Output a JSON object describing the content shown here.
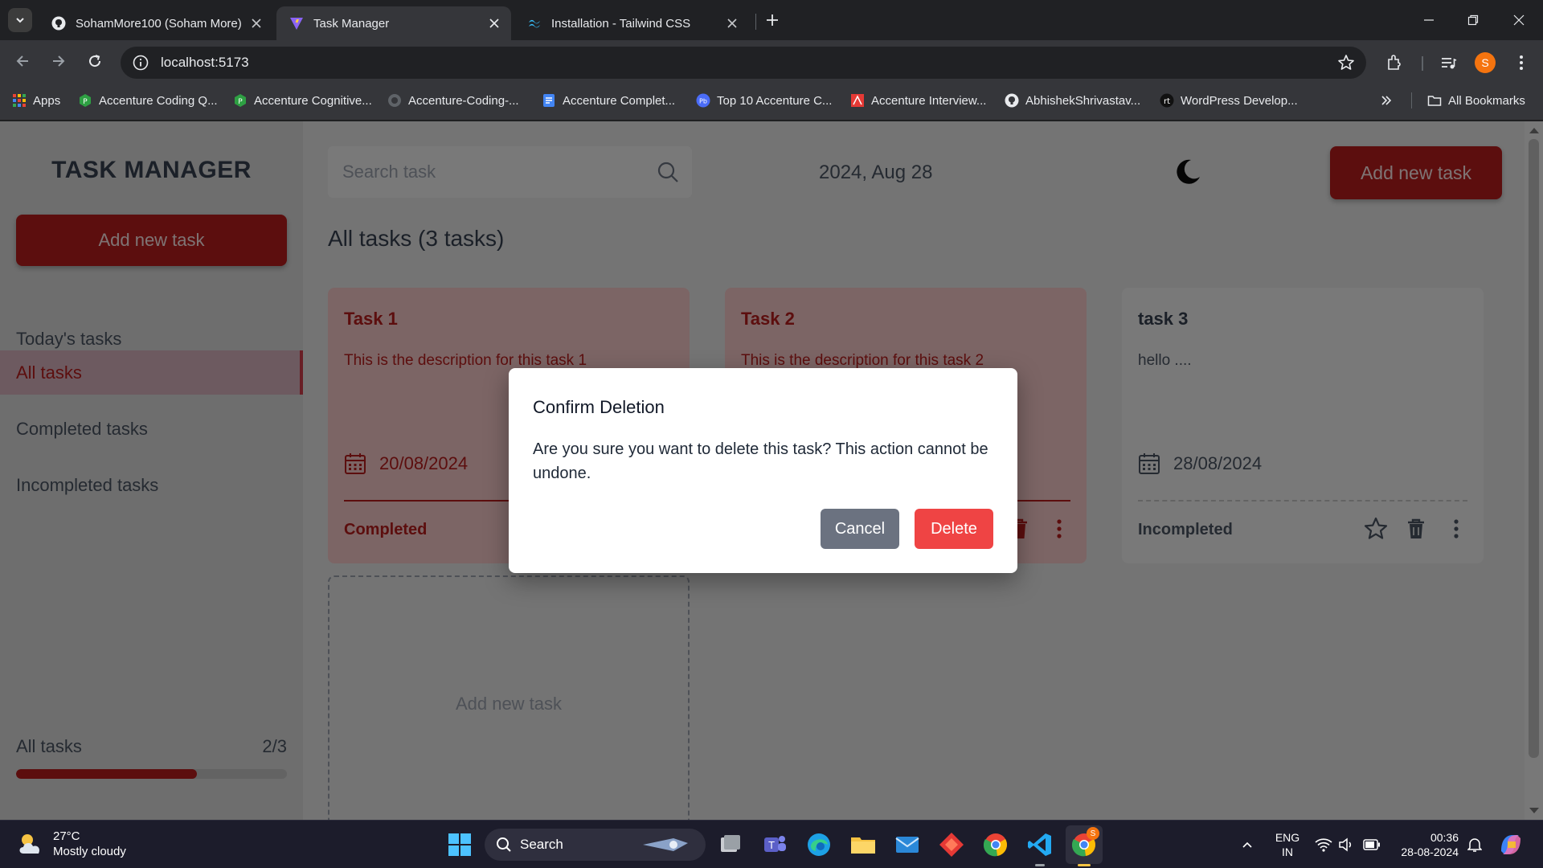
{
  "browser": {
    "tabs": [
      {
        "label": "SohamMore100 (Soham More)",
        "active": false
      },
      {
        "label": "Task Manager",
        "active": true
      },
      {
        "label": "Installation - Tailwind CSS",
        "active": false
      }
    ],
    "url": "localhost:5173",
    "profile_initial": "S",
    "bookmarks": [
      "Apps",
      "Accenture Coding Q...",
      "Accenture Cognitive...",
      "Accenture-Coding-...",
      "Accenture Complet...",
      "Top 10 Accenture C...",
      "Accenture Interview...",
      "AbhishekShrivastav...",
      "WordPress Develop..."
    ],
    "all_bookmarks": "All Bookmarks"
  },
  "app": {
    "logo": "TASK MANAGER",
    "add_button": "Add new task",
    "nav": [
      "Today's tasks",
      "All tasks",
      "Completed tasks",
      "Incompleted tasks"
    ],
    "active_nav": "All tasks",
    "progress": {
      "label": "All tasks",
      "count": "2/3",
      "fraction": 0.667
    },
    "search_placeholder": "Search task",
    "date": "2024, Aug 28",
    "list_title": "All tasks (3 tasks)",
    "tasks": [
      {
        "title": "Task 1",
        "description": "This is the description for this task 1",
        "date": "20/08/2024",
        "status": "Completed"
      },
      {
        "title": "Task 2",
        "description": "This is the description for this task 2",
        "date": "",
        "status": ""
      },
      {
        "title": "task 3",
        "description": "hello ....",
        "date": "28/08/2024",
        "status": "Incompleted"
      }
    ],
    "add_card_label": "Add new task"
  },
  "modal": {
    "title": "Confirm Deletion",
    "message": "Are you sure you want to delete this task? This action cannot be undone.",
    "cancel": "Cancel",
    "delete": "Delete"
  },
  "taskbar": {
    "temperature": "27°C",
    "weather": "Mostly cloudy",
    "search": "Search",
    "lang_top": "ENG",
    "lang_bottom": "IN",
    "time": "00:36",
    "date": "28-08-2024",
    "badge": "S"
  },
  "colors": {
    "accent": "#b91c1c",
    "delete": "#ef4444",
    "cancel": "#6b7280"
  }
}
